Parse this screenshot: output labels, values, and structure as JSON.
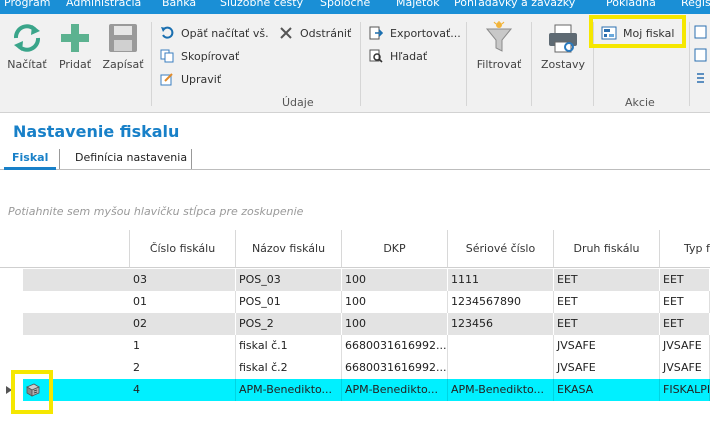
{
  "menu": [
    "Program",
    "Administrácia",
    "Banka",
    "Služobné cesty",
    "Spoločné",
    "Majetok",
    "Pohľadávky a záväzky",
    "Pokladňa",
    "Regis"
  ],
  "ribbon": {
    "nacitat": "Načítať",
    "pridat": "Pridať",
    "zapisat": "Zapísať",
    "opat_nacitat": "Opäť načítať vš.",
    "skopirovat": "Skopírovať",
    "upravit": "Upraviť",
    "odstranit": "Odstrániť",
    "exportovat": "Exportovať...",
    "hladat": "Hľadať",
    "filtrovat": "Filtrovať",
    "zostavy": "Zostavy",
    "moj_fiskal": "Moj fiskal",
    "group_udaje": "Údaje",
    "group_akcie": "Akcie"
  },
  "page_title": "Nastavenie fiskalu",
  "tabs": [
    "Fiskal",
    "Definícia nastavenia"
  ],
  "group_hint": "Potiahnite sem myšou hlavičku stĺpca pre zoskupenie",
  "grid": {
    "columns": [
      "Číslo fiskálu",
      "Názov fiskálu",
      "DKP",
      "Sériové číslo",
      "Druh fiskálu",
      "Typ f"
    ],
    "rows": [
      [
        "03",
        "POS_03",
        "100",
        "1111",
        "EET",
        "EET"
      ],
      [
        "01",
        "POS_01",
        "100",
        "1234567890",
        "EET",
        "EET"
      ],
      [
        "02",
        "POS_2",
        "100",
        "123456",
        "EET",
        "EET"
      ],
      [
        "1",
        "fiskal č.1",
        "6680031616992...",
        "",
        "JVSAFE",
        "JVSAFE"
      ],
      [
        "2",
        "fiskal č.2",
        "6680031616992...",
        "",
        "JVSAFE",
        "JVSAFE"
      ],
      [
        "4",
        "APM-Benedikto...",
        "APM-Benedikto...",
        "APM-Benedikto...",
        "EKASA",
        "FISKALPR"
      ]
    ],
    "selected_row": 5
  },
  "colors": {
    "accent": "#1880c8",
    "menubar": "#1a8fd6",
    "highlight": "#f5e700",
    "selected": "#00f0ff"
  }
}
